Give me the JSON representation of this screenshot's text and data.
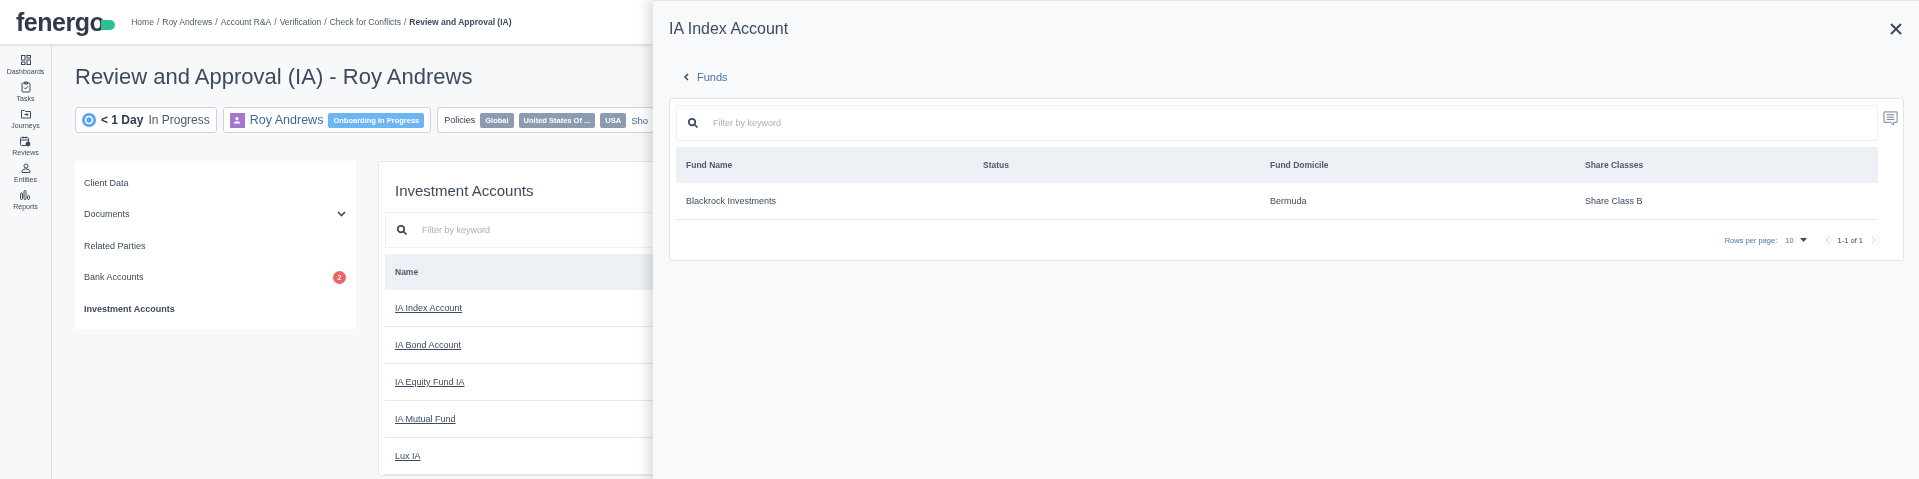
{
  "header": {
    "logo": "fenergo",
    "breadcrumb": [
      "Home",
      "Roy Andrews",
      "Account R&A",
      "Verification",
      "Check for Conflicts"
    ],
    "breadcrumb_current": "Review and Approval (IA)",
    "separator": "/"
  },
  "nav": [
    {
      "label": "Dashboards"
    },
    {
      "label": "Tasks"
    },
    {
      "label": "Journeys"
    },
    {
      "label": "Reviews"
    },
    {
      "label": "Entities"
    },
    {
      "label": "Reports"
    }
  ],
  "page_title": "Review and Approval (IA) - Roy Andrews",
  "status": {
    "duration": "< 1 Day",
    "state": "In Progress",
    "client": "Roy Andrews",
    "client_badge": "Onboarding In Progress",
    "policies_label": "Policies",
    "policies": [
      "Global",
      "United States Of ...",
      "USA"
    ],
    "more": "Sho"
  },
  "menu": [
    {
      "label": "Client Data",
      "selected": false
    },
    {
      "label": "Documents",
      "selected": false,
      "expandable": true
    },
    {
      "label": "Related Parties",
      "selected": false
    },
    {
      "label": "Bank Accounts",
      "selected": false,
      "count": "2"
    },
    {
      "label": "Investment Accounts",
      "selected": true
    }
  ],
  "accounts": {
    "title": "Investment Accounts",
    "search_placeholder": "Filter by keyword",
    "column": "Name",
    "rows": [
      "IA Index Account",
      "IA Bond Account",
      "IA Equity Fund IA",
      "IA Mutual Fund",
      "Lux IA"
    ]
  },
  "drawer": {
    "title": "IA Index Account",
    "back_label": "Funds",
    "search_placeholder": "Filter by keyword",
    "columns": [
      "Fund Name",
      "Status",
      "Fund Domicile",
      "Share Classes"
    ],
    "rows": [
      [
        "Blackrock Investments",
        "",
        "Bermuda",
        "Share Class B"
      ]
    ],
    "rows_per_page_label": "Rows per page:",
    "rows_per_page": "10",
    "range": "1-1 of 1"
  }
}
